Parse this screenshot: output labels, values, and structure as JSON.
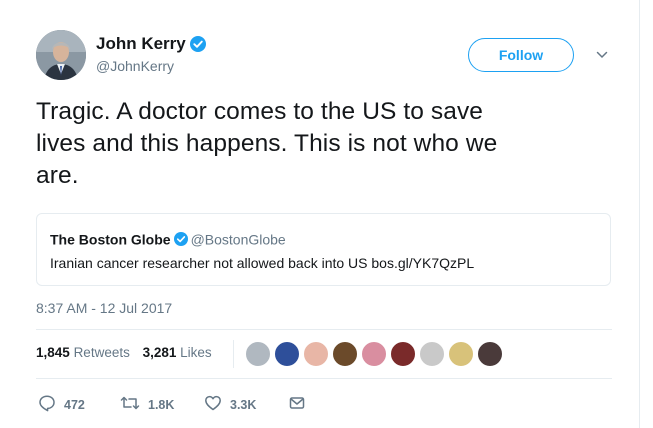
{
  "author": {
    "display_name": "John Kerry",
    "handle": "@JohnKerry",
    "verified": true
  },
  "follow_button": {
    "label": "Follow"
  },
  "tweet": {
    "line1": "Tragic. A doctor comes to the US to save",
    "line2": "lives and this happens. This is not who we",
    "line3": "are."
  },
  "quoted_tweet": {
    "display_name": "The Boston Globe",
    "handle": "@BostonGlobe",
    "text": "Iranian cancer researcher not allowed back into US bos.gl/YK7QzPL"
  },
  "timestamp": "8:37 AM - 12 Jul 2017",
  "stats": {
    "retweets_count": "1,845",
    "retweets_label": "Retweets",
    "likes_count": "3,281",
    "likes_label": "Likes"
  },
  "likers": [
    {
      "color": "#b0b8c0"
    },
    {
      "color": "#2e4f9a"
    },
    {
      "color": "#e8b6a6"
    },
    {
      "color": "#6b4a2a"
    },
    {
      "color": "#d98ea0"
    },
    {
      "color": "#7a2a2a"
    },
    {
      "color": "#c9c9c9"
    },
    {
      "color": "#d8c27a"
    },
    {
      "color": "#4a3a3a"
    }
  ],
  "actions": {
    "reply_count": "472",
    "retweet_count": "1.8K",
    "like_count": "3.3K"
  },
  "colors": {
    "accent": "#1da1f2",
    "secondary_text": "#657786",
    "primary_text": "#14171a",
    "border": "#e6ecf0"
  }
}
